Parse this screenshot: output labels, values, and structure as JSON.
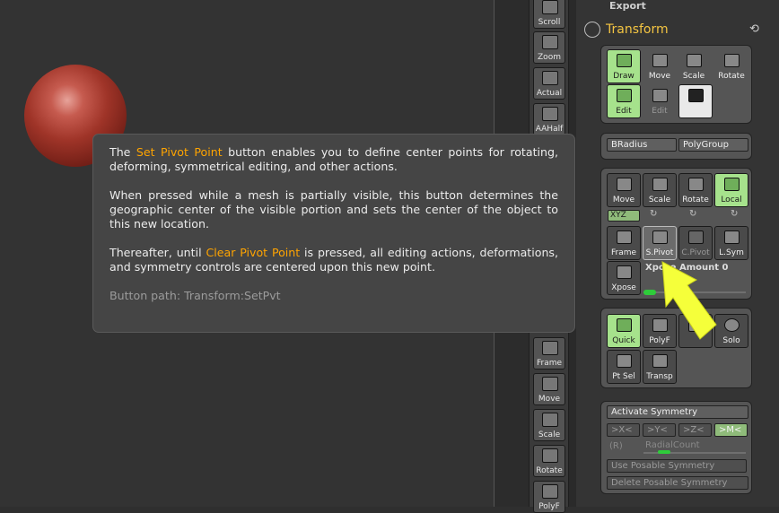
{
  "shelf": {
    "buttons": [
      {
        "label": "Scroll"
      },
      {
        "label": "Zoom"
      },
      {
        "label": "Actual"
      },
      {
        "label": "AAHalf"
      },
      {
        "label": "Frame"
      },
      {
        "label": "Move"
      },
      {
        "label": "Scale"
      },
      {
        "label": "Rotate"
      },
      {
        "label": "PolyF"
      }
    ]
  },
  "palette": {
    "export_label": "Export",
    "transform_title": "Transform",
    "top_tools": {
      "draw": "Draw",
      "move": "Move",
      "scale": "Scale",
      "rotate": "Rotate",
      "edit": "Edit",
      "edit_dim": "Edit"
    },
    "brush_row": {
      "bradius": "BRadius",
      "polygroup": "PolyGroup"
    },
    "gizmo": {
      "move": "Move",
      "scale": "Scale",
      "rotate": "Rotate",
      "local": "Local",
      "xyz": "XYZ"
    },
    "pivot": {
      "frame": "Frame",
      "spivot": "S.Pivot",
      "cpivot": "C.Pivot",
      "lsym": "L.Sym",
      "xpose": "Xpose",
      "xpose_amount": "Xpose Amount 0"
    },
    "display": {
      "quick": "Quick",
      "polyf": "PolyF",
      "solo": "Solo",
      "ptsel": "Pt Sel",
      "transp": "Transp"
    },
    "symmetry": {
      "activate": "Activate Symmetry",
      "x": ">X<",
      "y": ">Y<",
      "z": ">Z<",
      "m": ">M<",
      "r": "(R)",
      "radial_count": "RadialCount",
      "use_posable": "Use Posable Symmetry",
      "delete_posable": "Delete Posable Symmetry"
    }
  },
  "tooltip": {
    "p1_pre": "The ",
    "p1_hl": "Set Pivot Point",
    "p1_post": " button enables you to define center points for rotating, deforming, symmetrical editing, and other actions.",
    "p2": "When pressed while a mesh is partially visible, this button determines the geographic center of the visible portion and sets the center of the object to this new location.",
    "p3_pre": "Thereafter, until ",
    "p3_hl": "Clear Pivot Point",
    "p3_post": " is pressed, all editing actions, deformations, and symmetry controls are centered upon this new point.",
    "path": "Button path: Transform:SetPvt"
  },
  "colors": {
    "accent": "#f4c542",
    "toggle_on": "#a6e28c",
    "highlight": "#ffa400",
    "arrow": "#f5ff3a"
  },
  "icons": [
    "reset-icon",
    "transform-icon",
    "pointer-arrow"
  ]
}
